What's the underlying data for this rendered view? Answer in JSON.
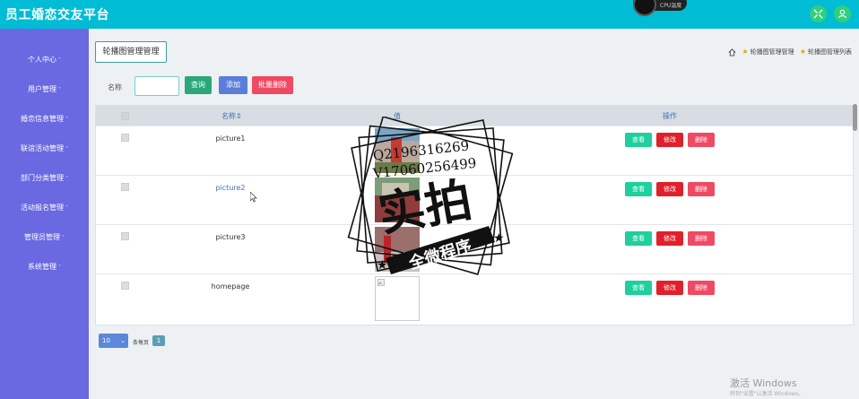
{
  "app": {
    "title": "员工婚恋交友平台",
    "cpu_widget": "CPU温度"
  },
  "header": {
    "left_button_icon": "shrink-icon",
    "right_button_icon": "user-icon"
  },
  "sidebar": {
    "items": [
      {
        "label": "个人中心"
      },
      {
        "label": "用户管理"
      },
      {
        "label": "婚恋信息管理"
      },
      {
        "label": "联谊活动管理"
      },
      {
        "label": "部门分类管理"
      },
      {
        "label": "活动报名管理"
      },
      {
        "label": "管理员管理"
      },
      {
        "label": "系统管理"
      }
    ],
    "arrow": "˅"
  },
  "page": {
    "tag": "轮播图管理管理",
    "breadcrumb": {
      "crumb1": "轮播图管理管理",
      "crumb2": "轮播图管理列表"
    }
  },
  "search": {
    "label": "名称",
    "value": "",
    "placeholder": "",
    "query_button": "查询",
    "add_button": "添加",
    "batch_delete_button": "批量删除"
  },
  "table": {
    "headers": {
      "name": "名称",
      "value": "值",
      "actions": "操作"
    },
    "rows": [
      {
        "name": "picture1"
      },
      {
        "name": "picture2"
      },
      {
        "name": "picture3"
      },
      {
        "name": "homepage"
      }
    ],
    "actions": {
      "view": "查看",
      "edit": "修改",
      "delete": "删除"
    }
  },
  "pagination": {
    "page_size": "10",
    "per_page_label": "条每页",
    "current_page": "1"
  },
  "watermark": {
    "line1": "Q2196316269",
    "line2": "V17060256499",
    "big": "实拍",
    "banner": "全微程序"
  },
  "windows": {
    "activate": "激活 Windows",
    "hint": "转到\"设置\"以激活 Windows。"
  },
  "colors": {
    "topbar": "#00bcd4",
    "sidebar": "#6a69e2",
    "query": "#2aa87a",
    "add": "#5b7ddb",
    "batch_delete": "#ef4a63",
    "view": "#1fcf9e",
    "edit": "#e0202b",
    "delete": "#ef4a63"
  }
}
